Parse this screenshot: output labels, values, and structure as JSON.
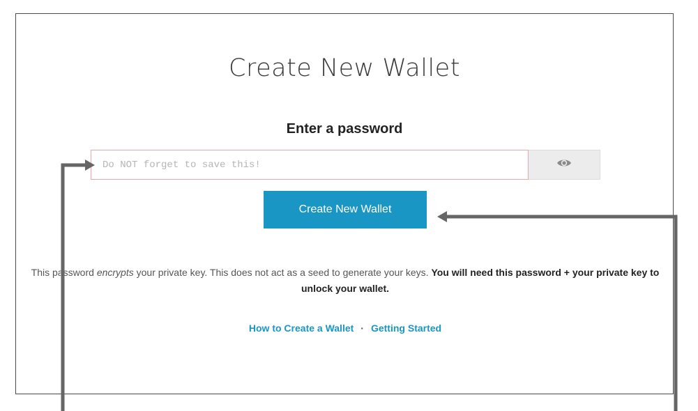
{
  "page": {
    "title": "Create New Wallet",
    "subtitle": "Enter a password"
  },
  "password_field": {
    "placeholder": "Do NOT forget to save this!",
    "value": ""
  },
  "toggle_visibility_icon": "eye-icon",
  "create_button": {
    "label": "Create New Wallet"
  },
  "info": {
    "part1": "This password ",
    "emphasis": "encrypts",
    "part2": " your private key. This does not act as a seed to generate your keys. ",
    "bold": "You will need this password + your private key to unlock your wallet."
  },
  "links": {
    "how_to": "How to Create a Wallet",
    "separator": "·",
    "getting_started": "Getting Started"
  },
  "colors": {
    "accent": "#1996c4",
    "input_border": "#f0a6a6",
    "annotation": "#666666"
  }
}
